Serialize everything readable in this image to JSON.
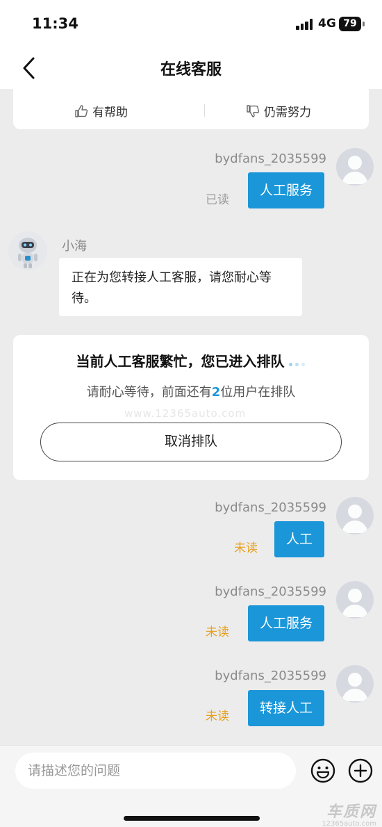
{
  "status_bar": {
    "time": "11:34",
    "network": "4G",
    "battery": "79"
  },
  "header": {
    "title": "在线客服"
  },
  "feedback": {
    "helpful": "有帮助",
    "need_effort": "仍需努力"
  },
  "messages": [
    {
      "sender": "bydfans_2035599",
      "text": "人工服务",
      "status": "已读"
    },
    {
      "sender": "小海",
      "text": "正在为您转接人工客服，请您耐心等待。"
    },
    {
      "sender": "bydfans_2035599",
      "text": "人工",
      "status": "未读"
    },
    {
      "sender": "bydfans_2035599",
      "text": "人工服务",
      "status": "未读"
    },
    {
      "sender": "bydfans_2035599",
      "text": "转接人工",
      "status": "未读"
    }
  ],
  "queue": {
    "title": "当前人工客服繁忙，您已进入排队",
    "subtitle_before": "请耐心等待，前面还有",
    "count": "2",
    "subtitle_after": "位用户在排队",
    "watermark": "www.12365auto.com",
    "cancel_label": "取消排队"
  },
  "input": {
    "placeholder": "请描述您的问题"
  },
  "logo": {
    "main": "车质网",
    "sub": "12365auto.com"
  },
  "colors": {
    "accent": "#1a96d9",
    "unread": "#e8a020",
    "background": "#ececec"
  }
}
